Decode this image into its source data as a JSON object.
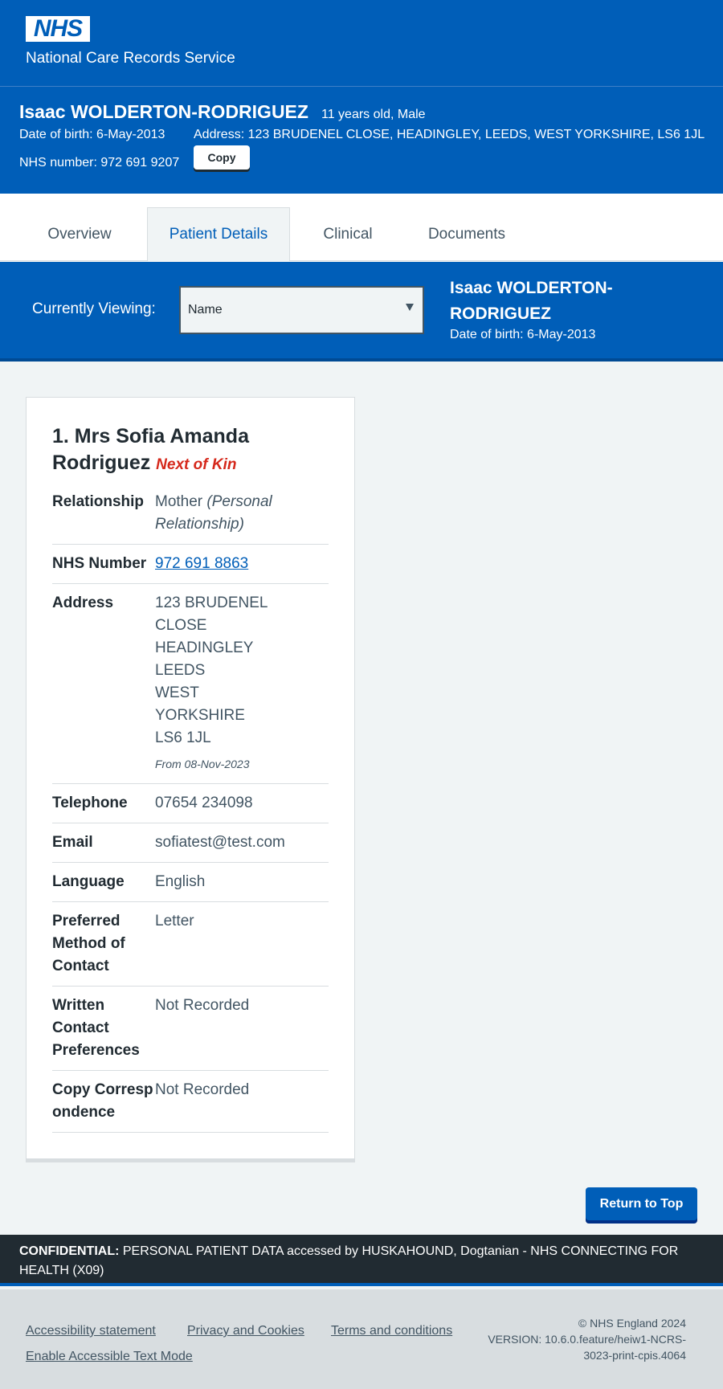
{
  "header": {
    "logo_text": "NHS",
    "service_name": "National Care Records Service"
  },
  "banner": {
    "patient_name": "Isaac WOLDERTON-RODRIGUEZ",
    "age_gender": "11 years old, Male",
    "dob": "Date of birth: 6-May-2013",
    "address": "Address: 123 BRUDENEL CLOSE, HEADINGLEY, LEEDS, WEST YORKSHIRE, LS6 1JL",
    "nhs_number": "NHS number: 972 691 9207",
    "copy_label": "Copy"
  },
  "tabs": [
    {
      "label": "Overview"
    },
    {
      "label": "Patient Details",
      "active": true
    },
    {
      "label": "Clinical"
    },
    {
      "label": "Documents"
    }
  ],
  "viewing": {
    "label": "Currently Viewing:",
    "selected": "Name",
    "patient_name": "Isaac WOLDERTON-RODRIGUEZ",
    "dob": "Date of birth: 6-May-2013"
  },
  "card": {
    "title": "1. Mrs Sofia Amanda Rodriguez",
    "badge": "Next of Kin",
    "relationship_label": "Relationship",
    "relationship_value": "Mother",
    "relationship_note": "(Personal Relationship)",
    "nhs_label": "NHS Number",
    "nhs_value": "972 691 8863",
    "address_label": "Address",
    "address_lines": [
      "123 BRUDENEL CLOSE",
      "HEADINGLEY",
      "LEEDS",
      "WEST YORKSHIRE",
      "LS6 1JL"
    ],
    "address_from": "From 08-Nov-2023",
    "telephone_label": "Telephone",
    "telephone_value": "07654 234098",
    "email_label": "Email",
    "email_value": "sofiatest@test.com",
    "language_label": "Language",
    "language_value": "English",
    "pmc_label": "Preferred Method of Contact",
    "pmc_value": "Letter",
    "wcp_label": "Written Contact Preferences",
    "wcp_value": "Not Recorded",
    "cc_label": "Copy Correspondence",
    "cc_value": "Not Recorded"
  },
  "return_label": "Return to Top",
  "confidential": {
    "bold": "CONFIDENTIAL:",
    "text": " PERSONAL PATIENT DATA accessed by HUSKAHOUND, Dogtanian - NHS CONNECTING FOR HEALTH (X09)"
  },
  "footer": {
    "links": [
      "Accessibility statement",
      "Privacy and Cookies",
      "Terms and conditions",
      "Enable Accessible Text Mode"
    ],
    "copyright": "© NHS England 2024",
    "version": "VERSION: 10.6.0.feature/heiw1-NCRS-3023-print-cpis.4064"
  },
  "colors": {
    "nhs_blue": "#005eb8",
    "dark": "#212b32",
    "text_secondary": "#425563",
    "red": "#d5281b",
    "grey_bg": "#f0f4f5"
  }
}
